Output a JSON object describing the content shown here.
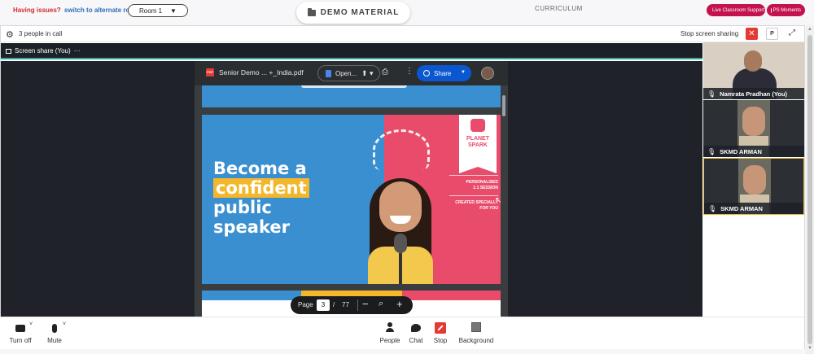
{
  "topbar": {
    "issues_text": "Having issues?",
    "alt_room_link": "switch to alternate room",
    "room_select": "Room 1",
    "demo_material": "DEMO MATERIAL",
    "curriculum": "CURRICULUM",
    "live_support": "Live Classroom Support",
    "ps_moments": "PS Moments"
  },
  "call": {
    "people_count": "3 people in call",
    "stop_sharing": "Stop screen sharing",
    "p_label": "P",
    "share_tab": "Screen share (You)"
  },
  "pdf": {
    "file_name": "Senior Demo ... +_India.pdf",
    "pdf_badge": "PDF",
    "open_label": "Open...",
    "share_label": "Share",
    "page_label": "Page",
    "current_page": "3",
    "page_sep": "/",
    "total_pages": "77"
  },
  "slide": {
    "line1": "Become a",
    "line2": "confident",
    "line3": "public",
    "line4": "speaker",
    "logo_line1": "PLANET",
    "logo_line2": "SPARK",
    "info1": "PERSONALISED",
    "info2": "1:1 SESSION",
    "info3": "CREATED SPECIALLY",
    "info4": "FOR YOU",
    "colors": {
      "blue": "#3a8fd0",
      "pink": "#e94b6b",
      "yellow": "#f4b72b"
    }
  },
  "participants": [
    {
      "name": "Namrata Pradhan (You)"
    },
    {
      "name": "SKMD ARMAN"
    },
    {
      "name": "SKMD ARMAN"
    }
  ],
  "controls": {
    "turn_off": "Turn off",
    "mute": "Mute",
    "people": "People",
    "chat": "Chat",
    "stop": "Stop",
    "background": "Background"
  },
  "colors": {
    "accent_red": "#e53935",
    "brand_pink": "#c4124e",
    "share_blue": "#0b57d0",
    "active_speaker": "#e2b63a"
  }
}
